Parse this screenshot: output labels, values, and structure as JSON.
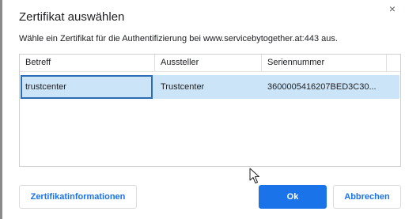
{
  "dialog": {
    "title": "Zertifikat auswählen",
    "close_label": "×",
    "description": "Wähle ein Zertifikat für die Authentifizierung bei www.servicebytogether.at:443 aus."
  },
  "table": {
    "columns": [
      "Betreff",
      "Aussteller",
      "Seriennummer"
    ],
    "rows": [
      [
        "trustcenter",
        "Trustcenter",
        "3600005416207BED3C30..."
      ]
    ]
  },
  "buttons": {
    "info": "Zertifikatinformationen",
    "ok": "Ok",
    "cancel": "Abbrechen"
  },
  "colors": {
    "accent": "#1a73e8",
    "selection": "#cce4f7",
    "focus_border": "#2b6cb5"
  },
  "icons": {
    "close": "close-icon",
    "cursor": "mouse-pointer-icon"
  }
}
